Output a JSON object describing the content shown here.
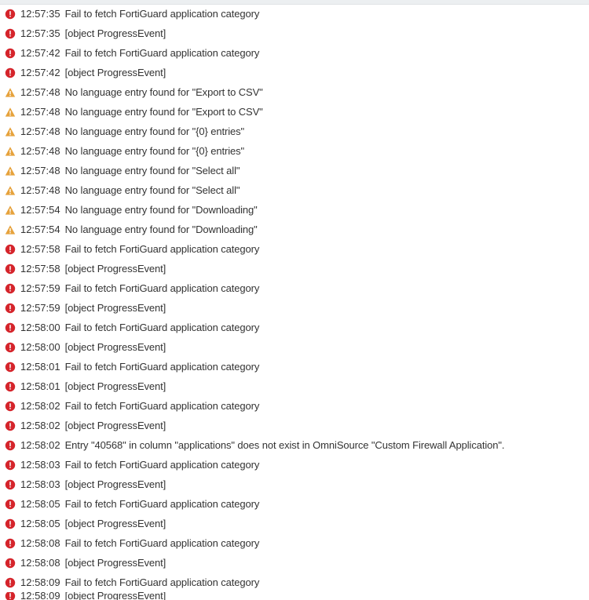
{
  "colors": {
    "error": "#d5242b",
    "warning": "#e6a23c"
  },
  "entries": [
    {
      "severity": "error",
      "icon": "error-icon",
      "time": "12:57:35",
      "message": "Fail to fetch FortiGuard application category"
    },
    {
      "severity": "error",
      "icon": "error-icon",
      "time": "12:57:35",
      "message": "[object ProgressEvent]"
    },
    {
      "severity": "error",
      "icon": "error-icon",
      "time": "12:57:42",
      "message": "Fail to fetch FortiGuard application category"
    },
    {
      "severity": "error",
      "icon": "error-icon",
      "time": "12:57:42",
      "message": "[object ProgressEvent]"
    },
    {
      "severity": "warning",
      "icon": "warning-icon",
      "time": "12:57:48",
      "message": "No language entry found for \"Export to CSV\""
    },
    {
      "severity": "warning",
      "icon": "warning-icon",
      "time": "12:57:48",
      "message": "No language entry found for \"Export to CSV\""
    },
    {
      "severity": "warning",
      "icon": "warning-icon",
      "time": "12:57:48",
      "message": "No language entry found for \"{0} entries\""
    },
    {
      "severity": "warning",
      "icon": "warning-icon",
      "time": "12:57:48",
      "message": "No language entry found for \"{0} entries\""
    },
    {
      "severity": "warning",
      "icon": "warning-icon",
      "time": "12:57:48",
      "message": "No language entry found for \"Select all\""
    },
    {
      "severity": "warning",
      "icon": "warning-icon",
      "time": "12:57:48",
      "message": "No language entry found for \"Select all\""
    },
    {
      "severity": "warning",
      "icon": "warning-icon",
      "time": "12:57:54",
      "message": "No language entry found for \"Downloading\""
    },
    {
      "severity": "warning",
      "icon": "warning-icon",
      "time": "12:57:54",
      "message": "No language entry found for \"Downloading\""
    },
    {
      "severity": "error",
      "icon": "error-icon",
      "time": "12:57:58",
      "message": "Fail to fetch FortiGuard application category"
    },
    {
      "severity": "error",
      "icon": "error-icon",
      "time": "12:57:58",
      "message": "[object ProgressEvent]"
    },
    {
      "severity": "error",
      "icon": "error-icon",
      "time": "12:57:59",
      "message": "Fail to fetch FortiGuard application category"
    },
    {
      "severity": "error",
      "icon": "error-icon",
      "time": "12:57:59",
      "message": "[object ProgressEvent]"
    },
    {
      "severity": "error",
      "icon": "error-icon",
      "time": "12:58:00",
      "message": "Fail to fetch FortiGuard application category"
    },
    {
      "severity": "error",
      "icon": "error-icon",
      "time": "12:58:00",
      "message": "[object ProgressEvent]"
    },
    {
      "severity": "error",
      "icon": "error-icon",
      "time": "12:58:01",
      "message": "Fail to fetch FortiGuard application category"
    },
    {
      "severity": "error",
      "icon": "error-icon",
      "time": "12:58:01",
      "message": "[object ProgressEvent]"
    },
    {
      "severity": "error",
      "icon": "error-icon",
      "time": "12:58:02",
      "message": "Fail to fetch FortiGuard application category"
    },
    {
      "severity": "error",
      "icon": "error-icon",
      "time": "12:58:02",
      "message": "[object ProgressEvent]"
    },
    {
      "severity": "error",
      "icon": "error-icon",
      "time": "12:58:02",
      "message": "Entry \"40568\" in column \"applications\" does not exist in OmniSource \"Custom Firewall Application\"."
    },
    {
      "severity": "error",
      "icon": "error-icon",
      "time": "12:58:03",
      "message": "Fail to fetch FortiGuard application category"
    },
    {
      "severity": "error",
      "icon": "error-icon",
      "time": "12:58:03",
      "message": "[object ProgressEvent]"
    },
    {
      "severity": "error",
      "icon": "error-icon",
      "time": "12:58:05",
      "message": "Fail to fetch FortiGuard application category"
    },
    {
      "severity": "error",
      "icon": "error-icon",
      "time": "12:58:05",
      "message": "[object ProgressEvent]"
    },
    {
      "severity": "error",
      "icon": "error-icon",
      "time": "12:58:08",
      "message": "Fail to fetch FortiGuard application category"
    },
    {
      "severity": "error",
      "icon": "error-icon",
      "time": "12:58:08",
      "message": "[object ProgressEvent]"
    },
    {
      "severity": "error",
      "icon": "error-icon",
      "time": "12:58:09",
      "message": "Fail to fetch FortiGuard application category"
    }
  ],
  "partial_entry": {
    "severity": "error",
    "icon": "error-icon",
    "time": "12:58:09",
    "message": "[object ProgressEvent]"
  }
}
